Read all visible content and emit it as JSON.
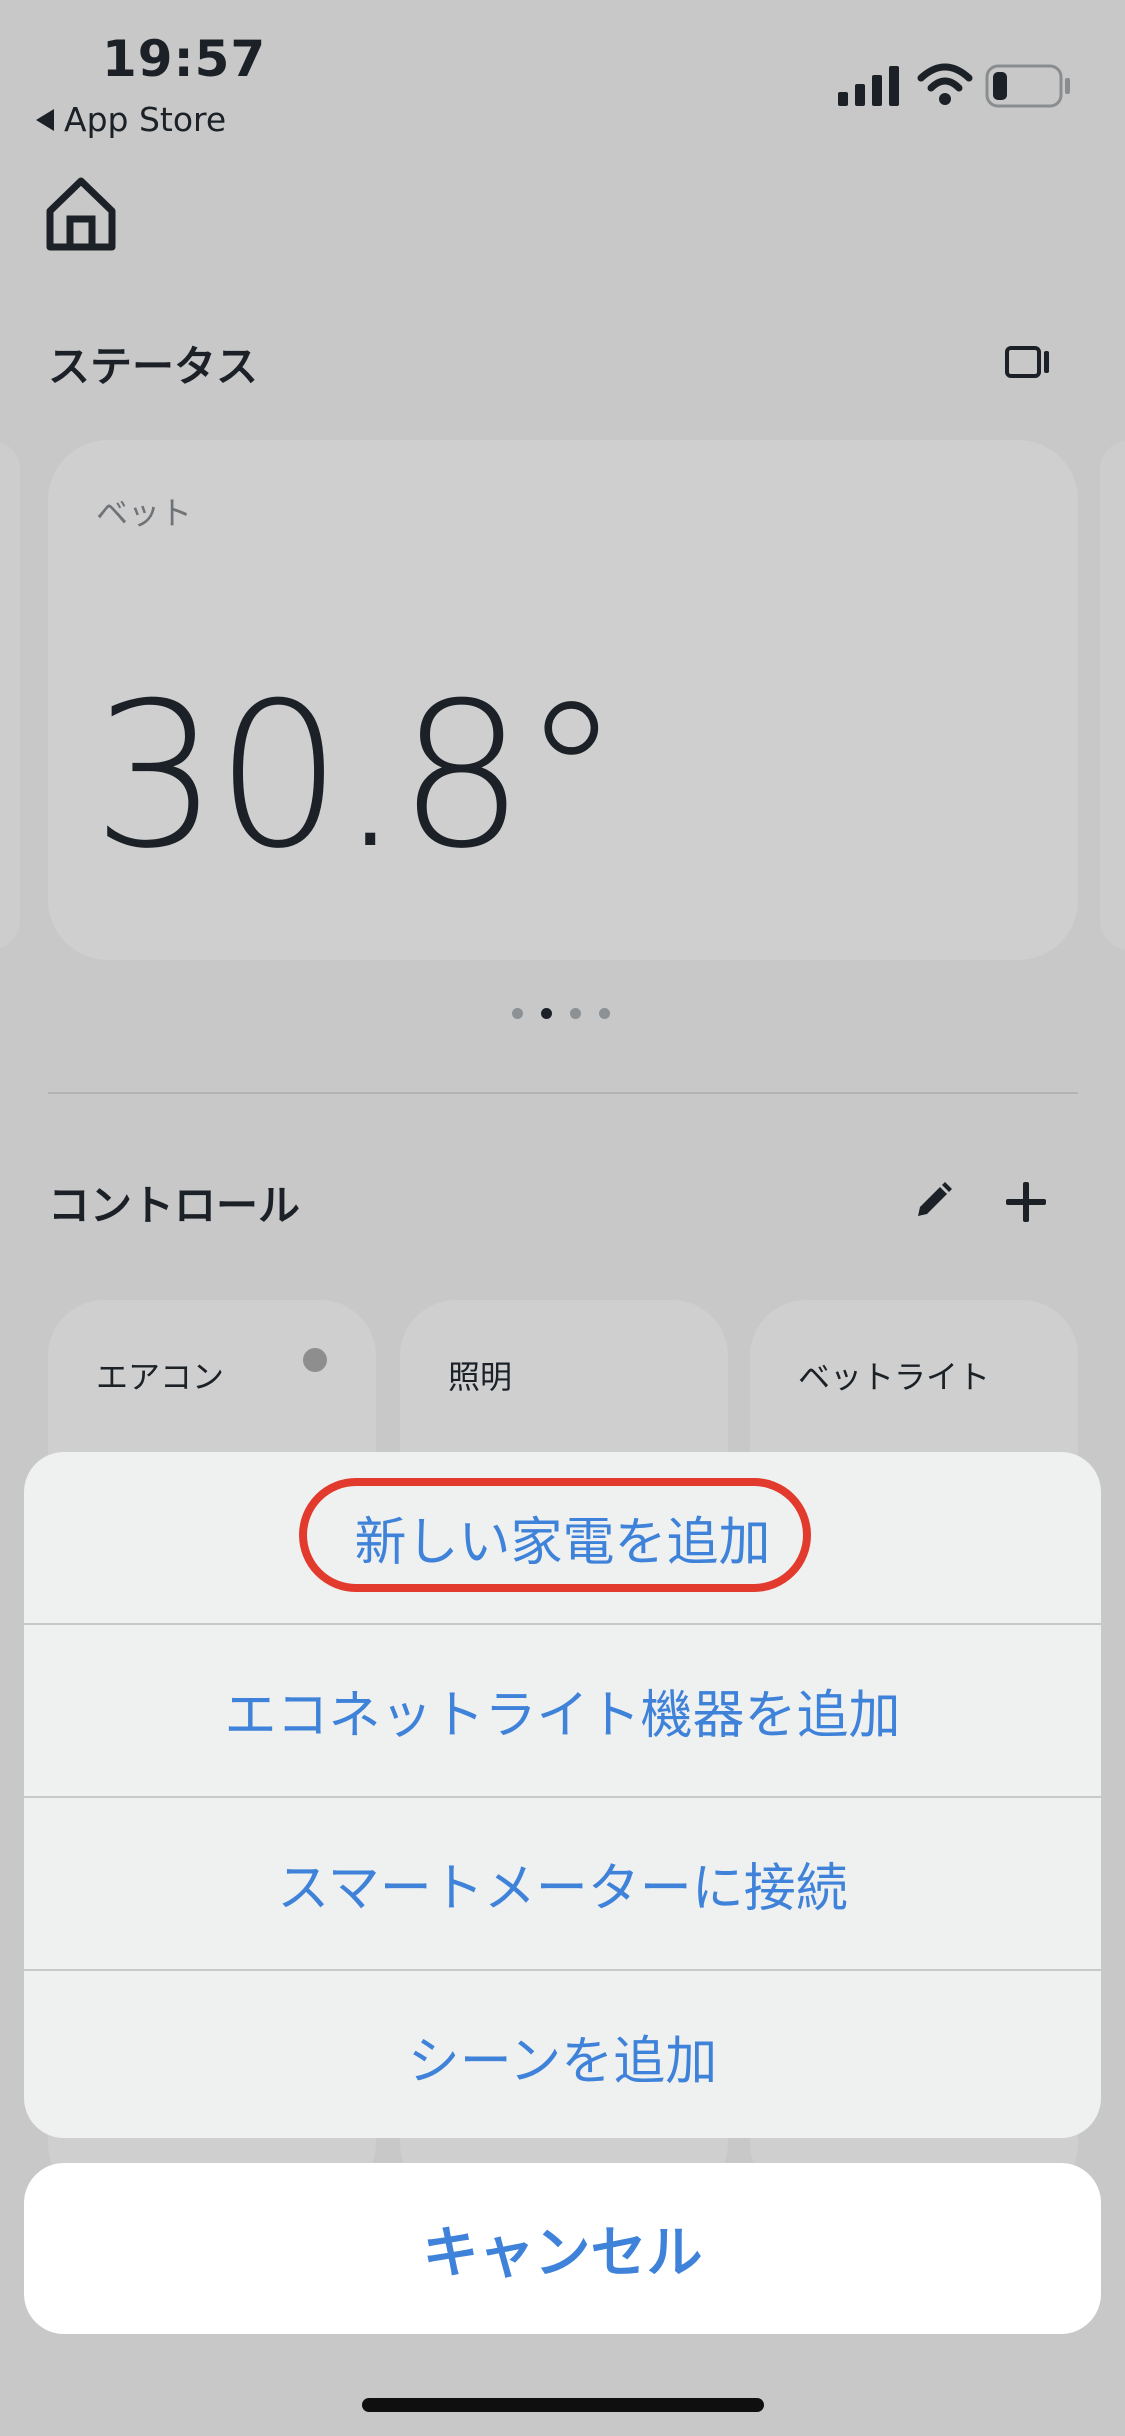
{
  "status_bar": {
    "time": "19:57",
    "back_label": "App Store"
  },
  "header": {
    "status_title": "ステータス"
  },
  "status_card": {
    "label": "ベット",
    "temperature": "30.8°",
    "page_count": 4,
    "active_page": 1
  },
  "controls": {
    "title": "コントロール",
    "tiles": [
      {
        "label": "エアコン"
      },
      {
        "label": "照明"
      },
      {
        "label": "ベットライト"
      }
    ]
  },
  "action_sheet": {
    "items": [
      {
        "label": "新しい家電を追加"
      },
      {
        "label": "エコネットライト機器を追加"
      },
      {
        "label": "スマートメーターに接続"
      },
      {
        "label": "シーンを追加"
      }
    ],
    "cancel_label": "キャンセル"
  },
  "colors": {
    "accent": "#3f82d9",
    "highlight": "#e23a2c",
    "dim_background": "#c8c8c8"
  }
}
